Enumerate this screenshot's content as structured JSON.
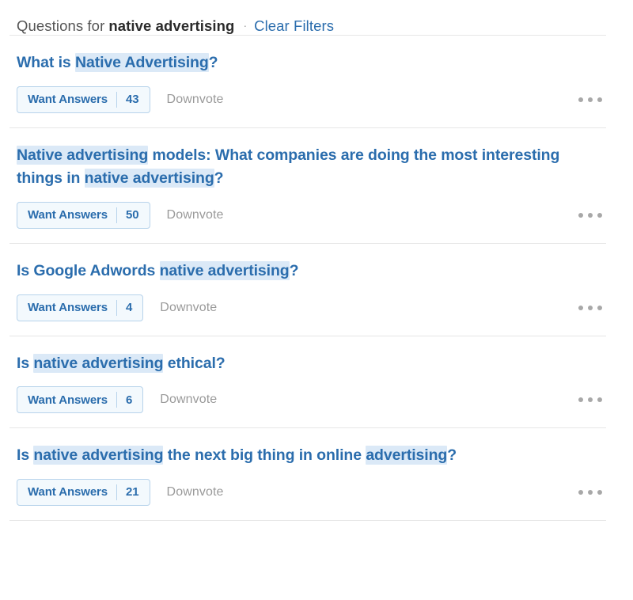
{
  "header": {
    "lead_text": "Questions for",
    "search_term": "native advertising",
    "bullet": "·",
    "clear_filters_label": "Clear Filters"
  },
  "actions": {
    "want_answers_label": "Want Answers",
    "downvote_label": "Downvote",
    "more_icon_name": "more-options-icon"
  },
  "questions": [
    {
      "segments": [
        {
          "text": "What is ",
          "highlight": false
        },
        {
          "text": "Native Advertising",
          "highlight": true
        },
        {
          "text": "?",
          "highlight": false
        }
      ],
      "plain_title": "What is Native Advertising?",
      "want_answers_count": "43"
    },
    {
      "segments": [
        {
          "text": "Native advertising",
          "highlight": true
        },
        {
          "text": " models: What companies are doing the most interesting things in ",
          "highlight": false
        },
        {
          "text": "native advertising",
          "highlight": true
        },
        {
          "text": "?",
          "highlight": false
        }
      ],
      "plain_title": "Native advertising models: What companies are doing the most interesting things in native advertising?",
      "want_answers_count": "50"
    },
    {
      "segments": [
        {
          "text": "Is Google Adwords ",
          "highlight": false
        },
        {
          "text": "native advertising",
          "highlight": true
        },
        {
          "text": "?",
          "highlight": false
        }
      ],
      "plain_title": "Is Google Adwords native advertising?",
      "want_answers_count": "4"
    },
    {
      "segments": [
        {
          "text": "Is ",
          "highlight": false
        },
        {
          "text": "native advertising",
          "highlight": true
        },
        {
          "text": " ethical?",
          "highlight": false
        }
      ],
      "plain_title": "Is native advertising ethical?",
      "want_answers_count": "6"
    },
    {
      "segments": [
        {
          "text": "Is ",
          "highlight": false
        },
        {
          "text": "native advertising",
          "highlight": true
        },
        {
          "text": " the next big thing in online ",
          "highlight": false
        },
        {
          "text": "advertising",
          "highlight": true
        },
        {
          "text": "?",
          "highlight": false
        }
      ],
      "plain_title": "Is native advertising the next big thing in online advertising?",
      "want_answers_count": "21"
    }
  ],
  "colors": {
    "link_blue": "#2b6dad",
    "highlight_blue": "#dbe9f7",
    "button_fill": "#f3f9fd",
    "button_border": "#b7d3eb",
    "muted_gray": "#9a9a9a",
    "divider_gray": "#e6e6e6"
  }
}
